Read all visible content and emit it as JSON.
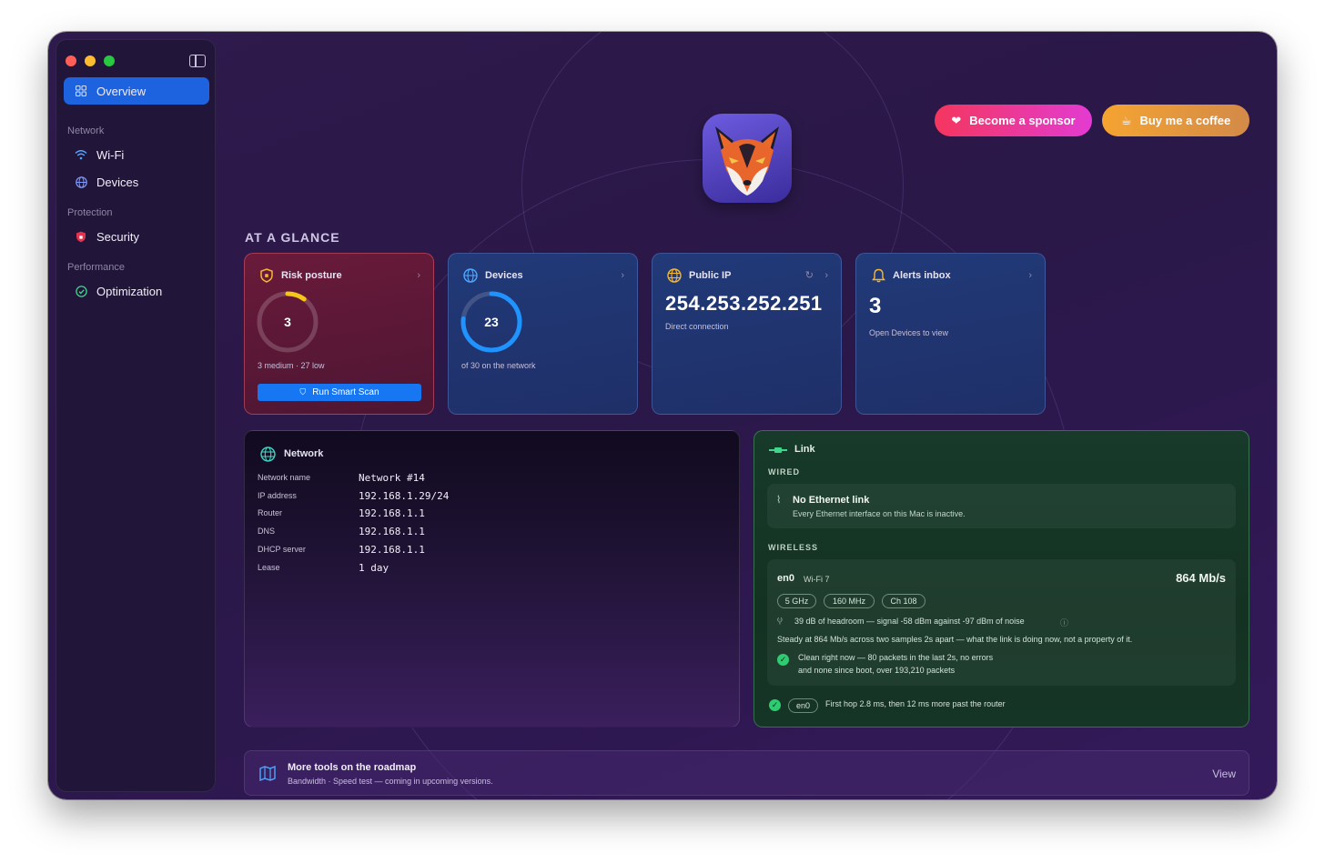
{
  "sidebar": {
    "items": [
      {
        "label": "Overview",
        "icon": "grid-icon",
        "active": true
      },
      {
        "label": "Wi-Fi",
        "icon": "wifi-icon"
      },
      {
        "label": "Devices",
        "icon": "globe-icon"
      },
      {
        "label": "Security",
        "icon": "shield-icon"
      },
      {
        "label": "Optimization",
        "icon": "gauge-icon"
      }
    ],
    "sections": [
      "Network",
      "Protection",
      "Performance"
    ]
  },
  "header": {
    "sponsor_label": "Become a sponsor",
    "coffee_label": "Buy me a coffee",
    "sponsor_color": "#f4365e",
    "coffee_color": "#f5a431"
  },
  "glance": {
    "title": "AT A GLANCE",
    "risk": {
      "title": "Risk posture",
      "value": "3",
      "ring_fraction": 0.1,
      "detail": "3 medium · 27 low",
      "button": "Run Smart Scan"
    },
    "devices": {
      "title": "Devices",
      "value": "23",
      "ring_fraction": 0.767,
      "detail": "of 30 on the network"
    },
    "public_ip": {
      "title": "Public IP",
      "value": "254.253.252.251",
      "detail": "Direct connection"
    },
    "alerts": {
      "title": "Alerts inbox",
      "value": "3",
      "detail": "Open Devices to view"
    }
  },
  "network": {
    "title": "Network",
    "rows": [
      {
        "key": "Network name",
        "value": "Network #14"
      },
      {
        "key": "IP address",
        "value": "192.168.1.29/24"
      },
      {
        "key": "Router",
        "value": "192.168.1.1"
      },
      {
        "key": "DNS",
        "value": "192.168.1.1"
      },
      {
        "key": "DHCP server",
        "value": "192.168.1.1"
      },
      {
        "key": "Lease",
        "value": "1 day"
      }
    ]
  },
  "link": {
    "title": "Link",
    "wired_label": "WIRED",
    "wired_title": "No Ethernet link",
    "wired_sub": "Every Ethernet interface on this Mac is inactive.",
    "wireless_label": "WIRELESS",
    "interface": "en0",
    "standard": "Wi-Fi 7",
    "speed": "864 Mb/s",
    "tags": [
      "5 GHz",
      "160 MHz",
      "Ch 108"
    ],
    "headroom": "39 dB of headroom — signal -58 dBm against -97 dBm of noise",
    "steady": "Steady at 864 Mb/s across two samples 2s apart — what the link is doing now, not a property of it.",
    "clean_line1": "Clean right now — 80 packets in the last 2s, no errors",
    "clean_line2": "and none since boot, over 193,210 packets",
    "hop_badge": "en0",
    "hop_text": "First hop 2.8 ms, then 12 ms more past the router"
  },
  "roadmap": {
    "title": "More tools on the roadmap",
    "sub": "Bandwidth · Speed test — coming in upcoming versions.",
    "view": "View"
  }
}
